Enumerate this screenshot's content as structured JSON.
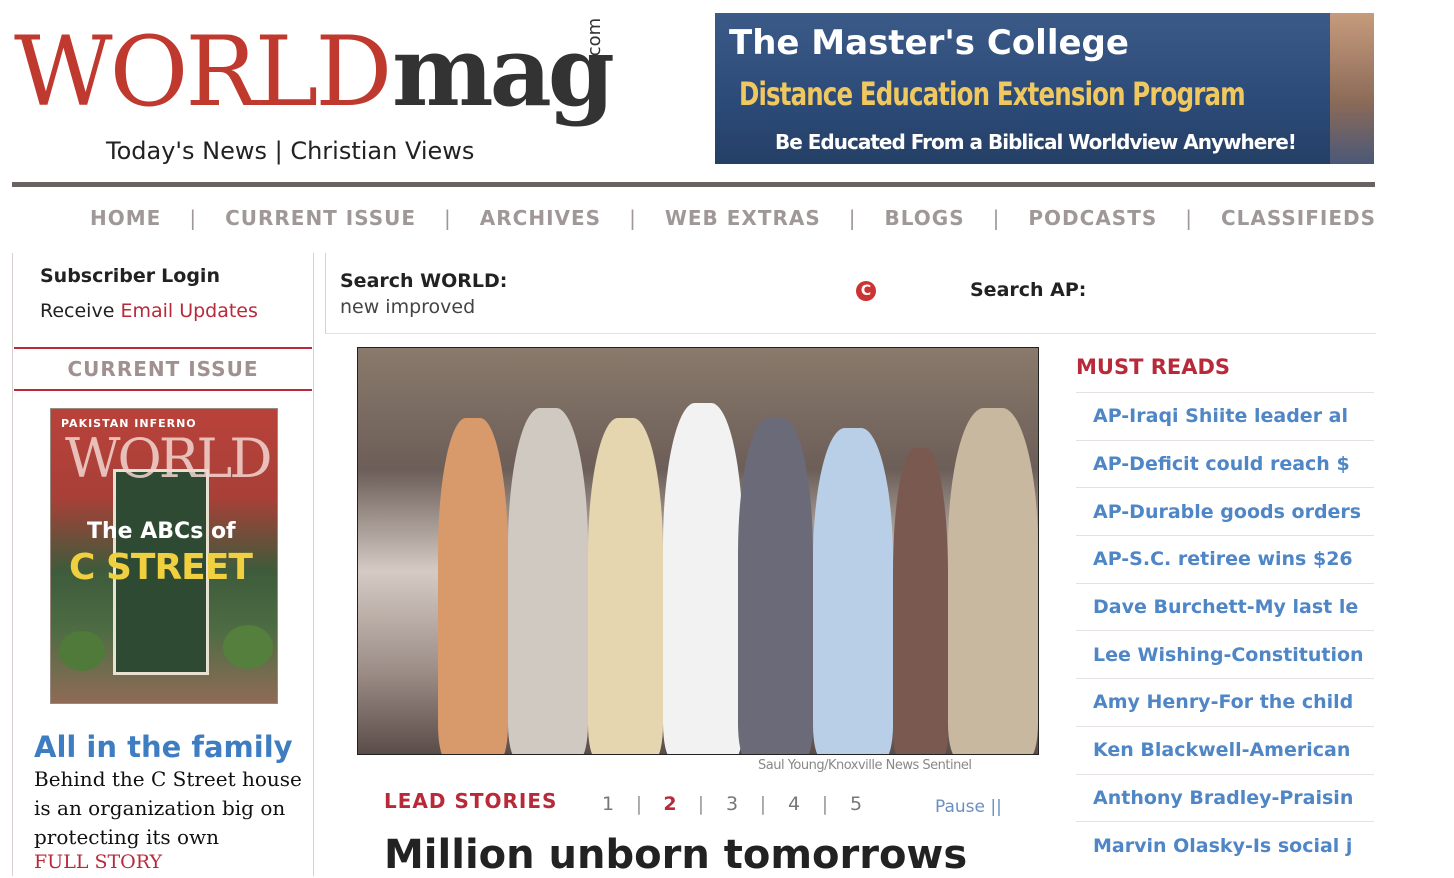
{
  "header": {
    "logo_world": "WORLD",
    "logo_mag": "mag",
    "logo_com": ".com",
    "tagline": "Today's News | Christian Views"
  },
  "banner": {
    "line1": "The Master's College",
    "line2": "Distance Education Extension Program",
    "line3": "Be Educated From a Biblical Worldview Anywhere!"
  },
  "nav": {
    "items": [
      "HOME",
      "CURRENT ISSUE",
      "ARCHIVES",
      "WEB EXTRAS",
      "BLOGS",
      "PODCASTS",
      "CLASSIFIEDS"
    ],
    "separator": "|"
  },
  "account": {
    "subscriber": "Subscriber",
    "login": "Login",
    "receive": "Receive",
    "email_updates": "Email Updates"
  },
  "current_issue": {
    "heading": "CURRENT ISSUE",
    "cover_kicker": "PAKISTAN INFERNO",
    "cover_logo": "WORLD",
    "cover_title1": "The ABCs of",
    "cover_title2": "C STREET",
    "feature_title": "All in the family",
    "feature_text": "Behind the C Street house is an organization big on protecting its own",
    "feature_link": "FULL STORY"
  },
  "search": {
    "world_label": "Search WORLD:",
    "world_sub": "new improved",
    "ap_label": "Search AP:",
    "icon_glyph": "C"
  },
  "hero": {
    "credit": "Saul Young/Knoxville News Sentinel"
  },
  "lead": {
    "label": "LEAD STORIES",
    "pages": [
      "1",
      "2",
      "3",
      "4",
      "5"
    ],
    "active_page": "2",
    "pause": "Pause ||",
    "headline": "Million unborn tomorrows"
  },
  "must_reads": {
    "heading": "MUST READS",
    "items": [
      "AP-Iraqi Shiite leader al",
      "AP-Deficit could reach $",
      "AP-Durable goods orders",
      "AP-S.C. retiree wins $26",
      "Dave Burchett-My last le",
      "Lee Wishing-Constitution",
      "Amy Henry-For the child",
      "Ken Blackwell-American",
      "Anthony Bradley-Praisin",
      "Marvin Olasky-Is social j"
    ]
  },
  "colors": {
    "brand_red": "#b8293a",
    "link_blue": "#4f86c6",
    "nav_gray": "#a09898"
  }
}
